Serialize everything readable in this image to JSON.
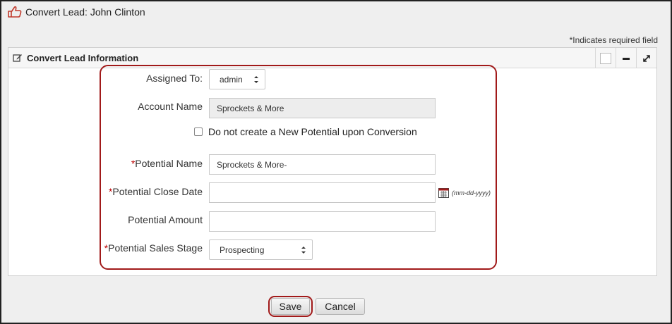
{
  "page": {
    "title": "Convert Lead: John Clinton",
    "required_note": "*Indicates required field"
  },
  "panel": {
    "title": "Convert Lead Information",
    "icons": [
      "edit-icon",
      "checkbox-square-icon",
      "minimize-icon",
      "expand-icon"
    ]
  },
  "form": {
    "assigned_to": {
      "label": "Assigned To:",
      "value": "admin"
    },
    "account_name": {
      "label": "Account Name",
      "value": "Sprockets & More"
    },
    "no_potential": {
      "label": "Do not create a New Potential upon Conversion",
      "checked": false
    },
    "potential_name": {
      "required": "*",
      "label": "Potential Name",
      "value": "Sprockets & More-"
    },
    "potential_close_date": {
      "required": "*",
      "label": "Potential Close Date",
      "value": "",
      "format_hint": "(mm-dd-yyyy)"
    },
    "potential_amount": {
      "label": "Potential Amount",
      "value": ""
    },
    "potential_sales_stage": {
      "required": "*",
      "label": "Potential Sales Stage",
      "value": "Prospecting"
    }
  },
  "actions": {
    "save_label": "Save",
    "cancel_label": "Cancel"
  },
  "colors": {
    "highlight": "#a11a1a",
    "required": "#bb0000",
    "lead_icon": "#c0392b"
  }
}
